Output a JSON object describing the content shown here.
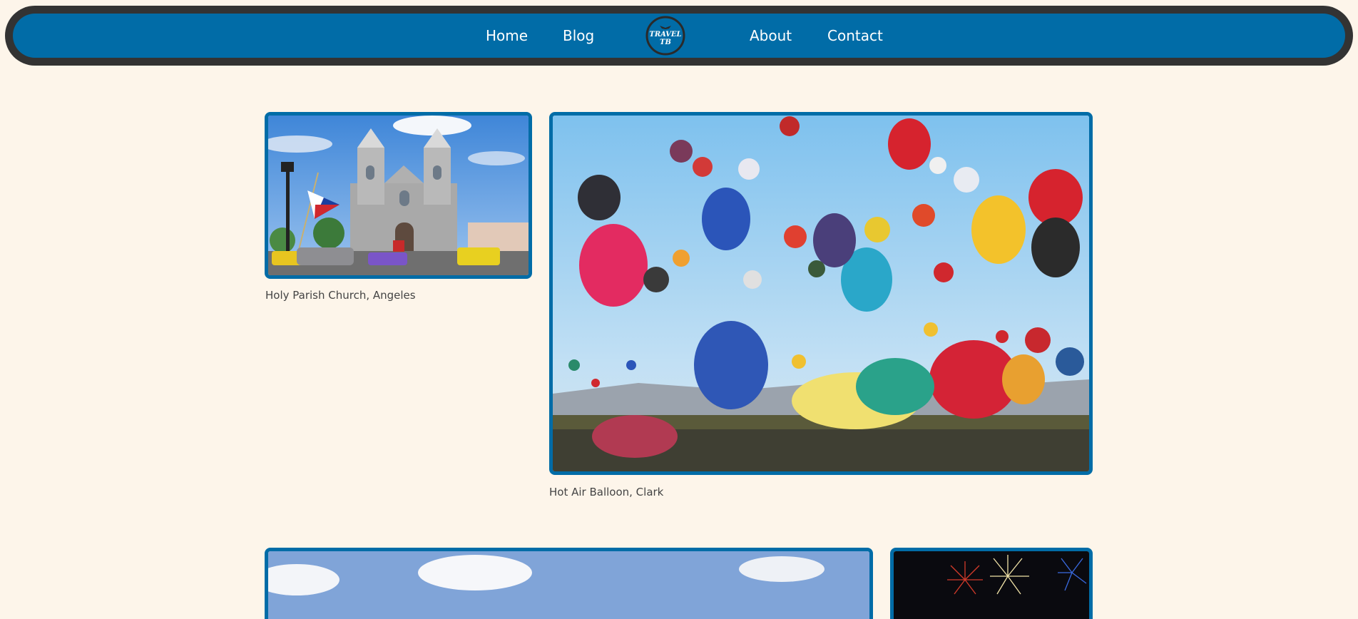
{
  "nav": {
    "links": [
      {
        "label": "Home"
      },
      {
        "label": "Blog"
      },
      {
        "label": "About"
      },
      {
        "label": "Contact"
      }
    ],
    "logo": {
      "line1": "TRAVEL",
      "line2": "TB",
      "icon": "airplane-icon"
    }
  },
  "colors": {
    "background": "#fdf5ea",
    "nav_blue": "#016ca7",
    "nav_border": "#333333",
    "frame_border": "#016ca7"
  },
  "gallery": {
    "items": [
      {
        "caption": "Holy Parish Church, Angeles",
        "image": "church-photo"
      },
      {
        "caption": "Hot Air Balloon, Clark",
        "image": "hot-air-balloons-photo"
      },
      {
        "caption": "",
        "image": "sky-clouds-photo"
      },
      {
        "caption": "",
        "image": "fireworks-photo"
      }
    ]
  }
}
